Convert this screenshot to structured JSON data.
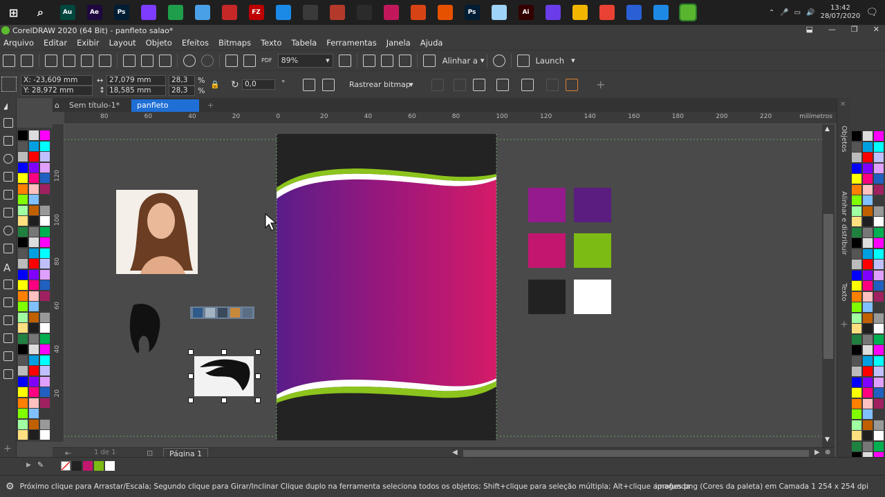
{
  "taskbar": {
    "apps": [
      {
        "name": "start-icon",
        "label": "",
        "color": "transparent"
      },
      {
        "name": "search-icon",
        "label": "",
        "color": "transparent"
      },
      {
        "name": "audition-icon",
        "label": "Au",
        "color": "#00473e"
      },
      {
        "name": "after-effects-icon",
        "label": "Ae",
        "color": "#1f0740"
      },
      {
        "name": "photoshop-icon",
        "label": "Ps",
        "color": "#001d34"
      },
      {
        "name": "affinity-icon",
        "label": "",
        "color": "#7d3cff"
      },
      {
        "name": "globe-icon",
        "label": "",
        "color": "#1e9e4a"
      },
      {
        "name": "document-icon",
        "label": "",
        "color": "#4aa0e6"
      },
      {
        "name": "app-red-icon",
        "label": "",
        "color": "#c62828"
      },
      {
        "name": "filezilla-icon",
        "label": "FZ",
        "color": "#bf0000"
      },
      {
        "name": "affinity-designer-icon",
        "label": "",
        "color": "#1b8ae6"
      },
      {
        "name": "pen-tool-icon",
        "label": "",
        "color": "#3a3a3a"
      },
      {
        "name": "gear-app-icon",
        "label": "",
        "color": "#b33a2a"
      },
      {
        "name": "obs-icon",
        "label": "",
        "color": "#2b2b2b"
      },
      {
        "name": "media-icon",
        "label": "",
        "color": "#c2185b"
      },
      {
        "name": "calendar-icon",
        "label": "",
        "color": "#d84315"
      },
      {
        "name": "hand-icon",
        "label": "",
        "color": "#e65100"
      },
      {
        "name": "photoshop2-icon",
        "label": "Ps",
        "color": "#001d34"
      },
      {
        "name": "notes-icon",
        "label": "",
        "color": "#9fd3f7"
      },
      {
        "name": "illustrator-icon",
        "label": "Ai",
        "color": "#330000"
      },
      {
        "name": "feather-icon",
        "label": "",
        "color": "#6a3de8"
      },
      {
        "name": "folder-icon",
        "label": "",
        "color": "#f2b600"
      },
      {
        "name": "chrome-icon",
        "label": "",
        "color": "#e94235"
      },
      {
        "name": "printer-icon",
        "label": "",
        "color": "#2a5fd6"
      },
      {
        "name": "store-icon",
        "label": "",
        "color": "#1e88e5"
      },
      {
        "name": "coreldraw-icon",
        "label": "",
        "color": "#5ab52e"
      }
    ],
    "time": "13:42",
    "date": "28/07/2020"
  },
  "window": {
    "title": "CorelDRAW 2020 (64 Bit) - panfleto salao*"
  },
  "menu": [
    "Arquivo",
    "Editar",
    "Exibir",
    "Layout",
    "Objeto",
    "Efeitos",
    "Bitmaps",
    "Texto",
    "Tabela",
    "Ferramentas",
    "Janela",
    "Ajuda"
  ],
  "toolbar1": {
    "zoom": "89%",
    "align_label": "Alinhar a",
    "launch_label": "Launch",
    "pdf_label": "PDF"
  },
  "propbar": {
    "x": "X: -23,609 mm",
    "y": "Y: 28,972 mm",
    "w": "27,079 mm",
    "h": "18,585 mm",
    "scale_w": "28,3",
    "scale_h": "28,3",
    "pct": "%",
    "angle": "0,0",
    "trace_label": "Rastrear bitmap"
  },
  "tabs": {
    "doc1": "Sem título-1*",
    "doc2": "panfleto salao*"
  },
  "ruler": {
    "h_ticks": [
      "80",
      "60",
      "40",
      "20",
      "0",
      "20",
      "40",
      "60",
      "80",
      "100",
      "120",
      "140",
      "160",
      "180",
      "200",
      "220"
    ],
    "unit": "milímetros",
    "v_ticks": [
      "120",
      "100",
      "80",
      "60",
      "40",
      "20"
    ]
  },
  "swatches": [
    {
      "name": "swatch-purple",
      "color": "#951a8d"
    },
    {
      "name": "swatch-dark-purple",
      "color": "#5b1d7f"
    },
    {
      "name": "swatch-magenta",
      "color": "#c3166f"
    },
    {
      "name": "swatch-green",
      "color": "#7cbb14"
    },
    {
      "name": "swatch-black",
      "color": "#222222"
    },
    {
      "name": "swatch-white",
      "color": "#ffffff"
    }
  ],
  "pager": {
    "page_info": "1 de 1",
    "page_label": "Página 1"
  },
  "dockers": {
    "objects": "Objetos",
    "align": "Alinhar e distribuir",
    "text": "Texto"
  },
  "status": {
    "hint": "Próximo clique para Arrastar/Escala; Segundo clique para Girar/Inclinar Clique duplo na ferramenta seleciona todos os objetos; Shift+clique para seleção múltipla; Alt+clique aprofunda",
    "info": "images.png (Cores da paleta) em Camada 1 254 x 254 dpi"
  }
}
